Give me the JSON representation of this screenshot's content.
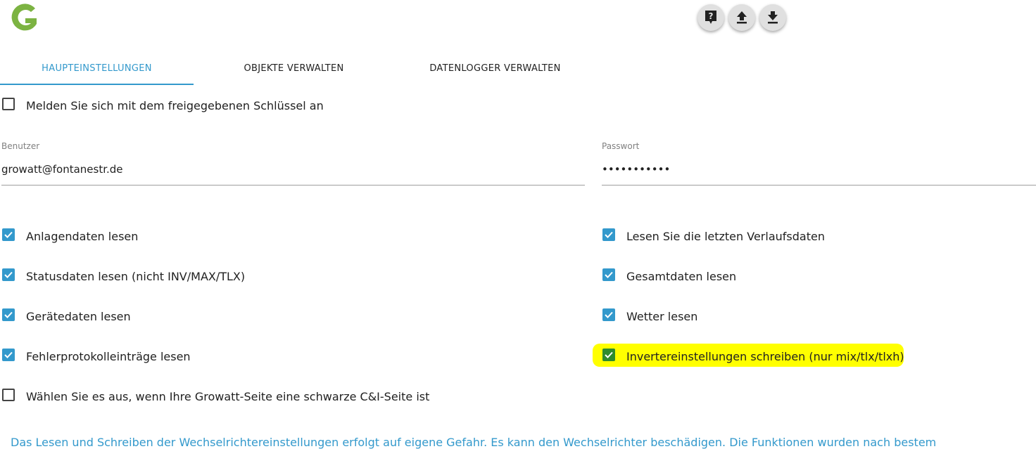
{
  "logo": {
    "icon": "growatt-logo-icon",
    "color": "#7cb342"
  },
  "toolbar": {
    "help_icon": "help-icon",
    "upload_icon": "upload-icon",
    "download_icon": "download-icon"
  },
  "tabs": [
    {
      "label": "HAUPTEINSTELLUNGEN",
      "active": true
    },
    {
      "label": "OBJEKTE VERWALTEN",
      "active": false
    },
    {
      "label": "DATENLOGGER VERWALTEN",
      "active": false
    }
  ],
  "shared_key": {
    "label": "Melden Sie sich mit dem freigegebenen Schlüssel an",
    "checked": false
  },
  "user": {
    "label": "Benutzer",
    "value": "growatt@fontanestr.de"
  },
  "password": {
    "label": "Passwort",
    "value": "•••••••••••"
  },
  "options_left": [
    {
      "label": "Anlagendaten lesen",
      "checked": true
    },
    {
      "label": "Statusdaten lesen (nicht INV/MAX/TLX)",
      "checked": true
    },
    {
      "label": "Gerätedaten lesen",
      "checked": true
    },
    {
      "label": "Fehlerprotokolleinträge lesen",
      "checked": true
    },
    {
      "label": "Wählen Sie es aus, wenn Ihre Growatt-Seite eine schwarze C&I-Seite ist",
      "checked": false
    }
  ],
  "options_right": [
    {
      "label": "Lesen Sie die letzten Verlaufsdaten",
      "checked": true
    },
    {
      "label": "Gesamtdaten lesen",
      "checked": true
    },
    {
      "label": "Wetter lesen",
      "checked": true
    },
    {
      "label": "Invertereinstellungen schreiben (nur mix/tlx/tlxh)",
      "checked": true,
      "highlighted": true
    }
  ],
  "warning": "Das Lesen und Schreiben der Wechselrichtereinstellungen erfolgt auf eigene Gefahr. Es kann den Wechselrichter beschädigen. Die Funktionen wurden nach bestem",
  "colors": {
    "accent": "#3399cc",
    "highlight": "#ffff00",
    "check_highlighted": "#2e8b2e"
  }
}
